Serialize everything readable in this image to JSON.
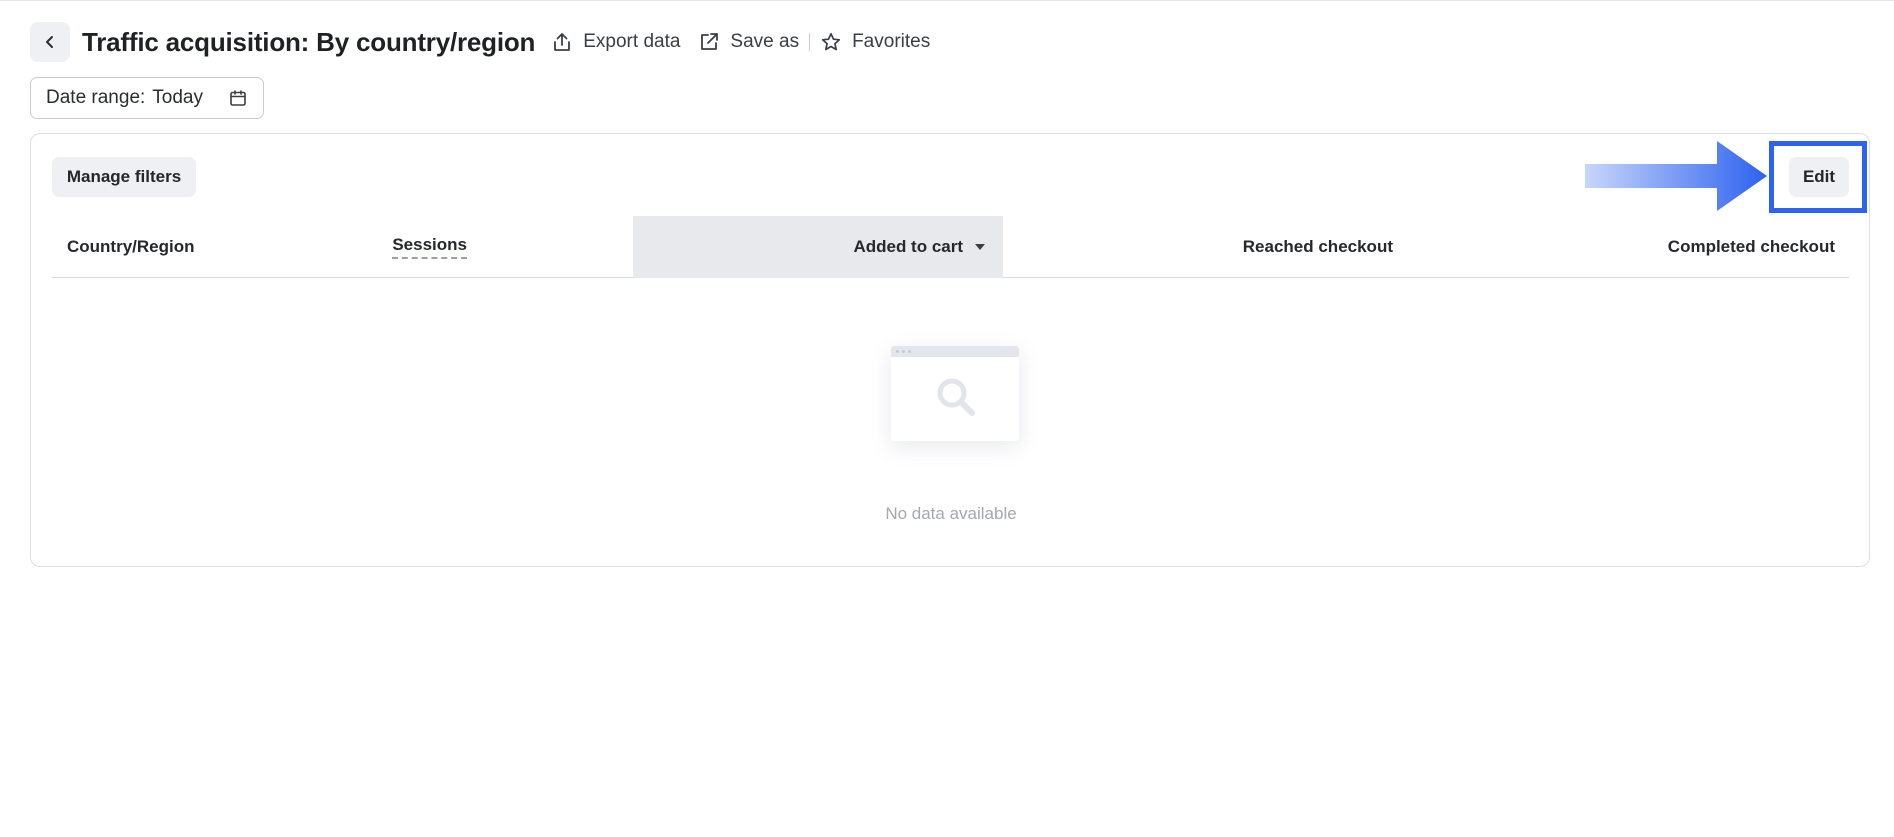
{
  "header": {
    "title": "Traffic acquisition: By country/region",
    "back_icon": "chevron-left-icon",
    "actions": {
      "export_label": "Export data",
      "save_as_label": "Save as",
      "favorites_label": "Favorites"
    }
  },
  "date_range": {
    "label": "Date range:",
    "value": "Today",
    "icon": "calendar-icon"
  },
  "panel": {
    "manage_filters_label": "Manage filters",
    "edit_label": "Edit",
    "annotation_color": "#2e62f0"
  },
  "table": {
    "columns": {
      "country": "Country/Region",
      "sessions": "Sessions",
      "added_to_cart": "Added to cart",
      "reached_checkout": "Reached checkout",
      "completed_checkout": "Completed checkout"
    },
    "sorted_column": "added_to_cart",
    "empty_message": "No data available"
  }
}
